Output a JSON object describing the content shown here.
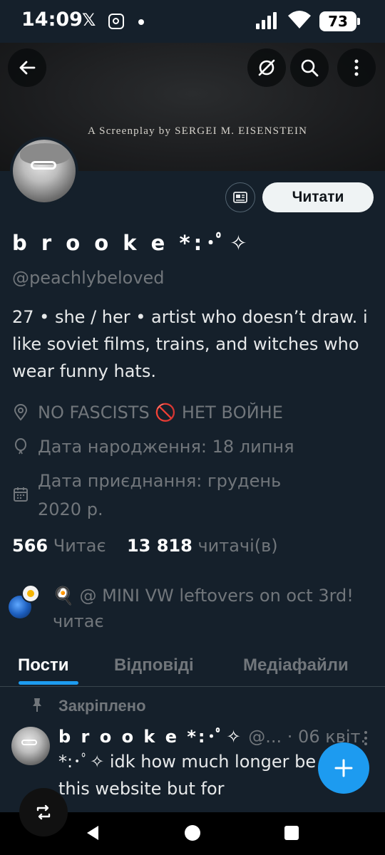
{
  "status_bar": {
    "time": "14:09",
    "x_app": "𝕏",
    "battery": "73"
  },
  "banner": {
    "text": "A Screenplay by SERGEI M. EISENSTEIN"
  },
  "header_buttons": {
    "back_icon": "arrow-left-icon",
    "grok_icon": "grok-icon",
    "search_icon": "search-icon",
    "more_icon": "more-vertical-icon"
  },
  "profile": {
    "display_name": "b r o o k e *:･ﾟ✧",
    "handle": "@peachlybeloved",
    "bio": "27 • she / her • artist who doesn’t draw. i like soviet films, trains, and witches who wear funny hats.",
    "location": "NO FASCISTS 🚫 НЕТ ВОЙНЕ",
    "birthday": "Дата народження: 18 липня",
    "joined_line1": "Дата приєднання: грудень",
    "joined_line2": "2020 р.",
    "follow_label": "Читати",
    "following_count": "566",
    "following_label": "Читає",
    "followers_count": "13 818",
    "followers_label": "читачі(в)"
  },
  "followed_by": {
    "text": "🍳 @ MINI VW leftovers on oct 3rd! читає"
  },
  "tabs": {
    "posts": "Пости",
    "replies": "Відповіді",
    "media": "Медіафайли"
  },
  "pinned_tweet": {
    "pinned_label": "Закріплено",
    "name": "b r o o k e *:･ﾟ✧",
    "handle": "@...",
    "date": "· 06 квіт.",
    "text": "*:･ﾟ✧ idk how much longer be using this website but for"
  },
  "colors": {
    "background": "#15202b",
    "accent": "#1d9bf0",
    "muted": "#71767b"
  }
}
